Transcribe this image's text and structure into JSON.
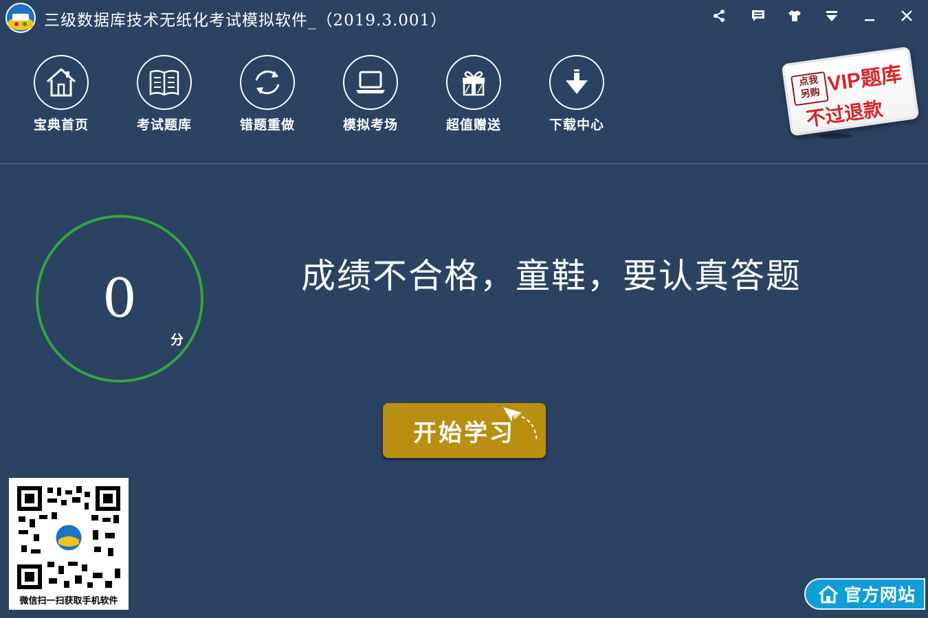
{
  "window": {
    "title": "三级数据库技术无纸化考试模拟软件_（2019.3.001）"
  },
  "nav": {
    "items": [
      {
        "label": "宝典首页",
        "icon": "home-icon"
      },
      {
        "label": "考试题库",
        "icon": "book-icon"
      },
      {
        "label": "错题重做",
        "icon": "refresh-icon"
      },
      {
        "label": "模拟考场",
        "icon": "laptop-icon"
      },
      {
        "label": "超值赠送",
        "icon": "gift-icon"
      },
      {
        "label": "下载中心",
        "icon": "download-icon"
      }
    ]
  },
  "vip": {
    "badge_line1": "点我",
    "badge_line2": "另购",
    "line1": "VIP题库",
    "line2": "不过退款"
  },
  "score": {
    "value": "0",
    "unit": "分"
  },
  "result_message": "成绩不合格，童鞋，要认真答题",
  "start_button": {
    "label": "开始学习"
  },
  "qr": {
    "caption": "微信扫一扫获取手机软件"
  },
  "official_site": {
    "label": "官方网站"
  },
  "colors": {
    "background": "#2b4262",
    "score_ring": "#36a243",
    "start_button": "#b98f10",
    "official_button": "#0f9ed8",
    "vip_red": "#d8232a"
  }
}
